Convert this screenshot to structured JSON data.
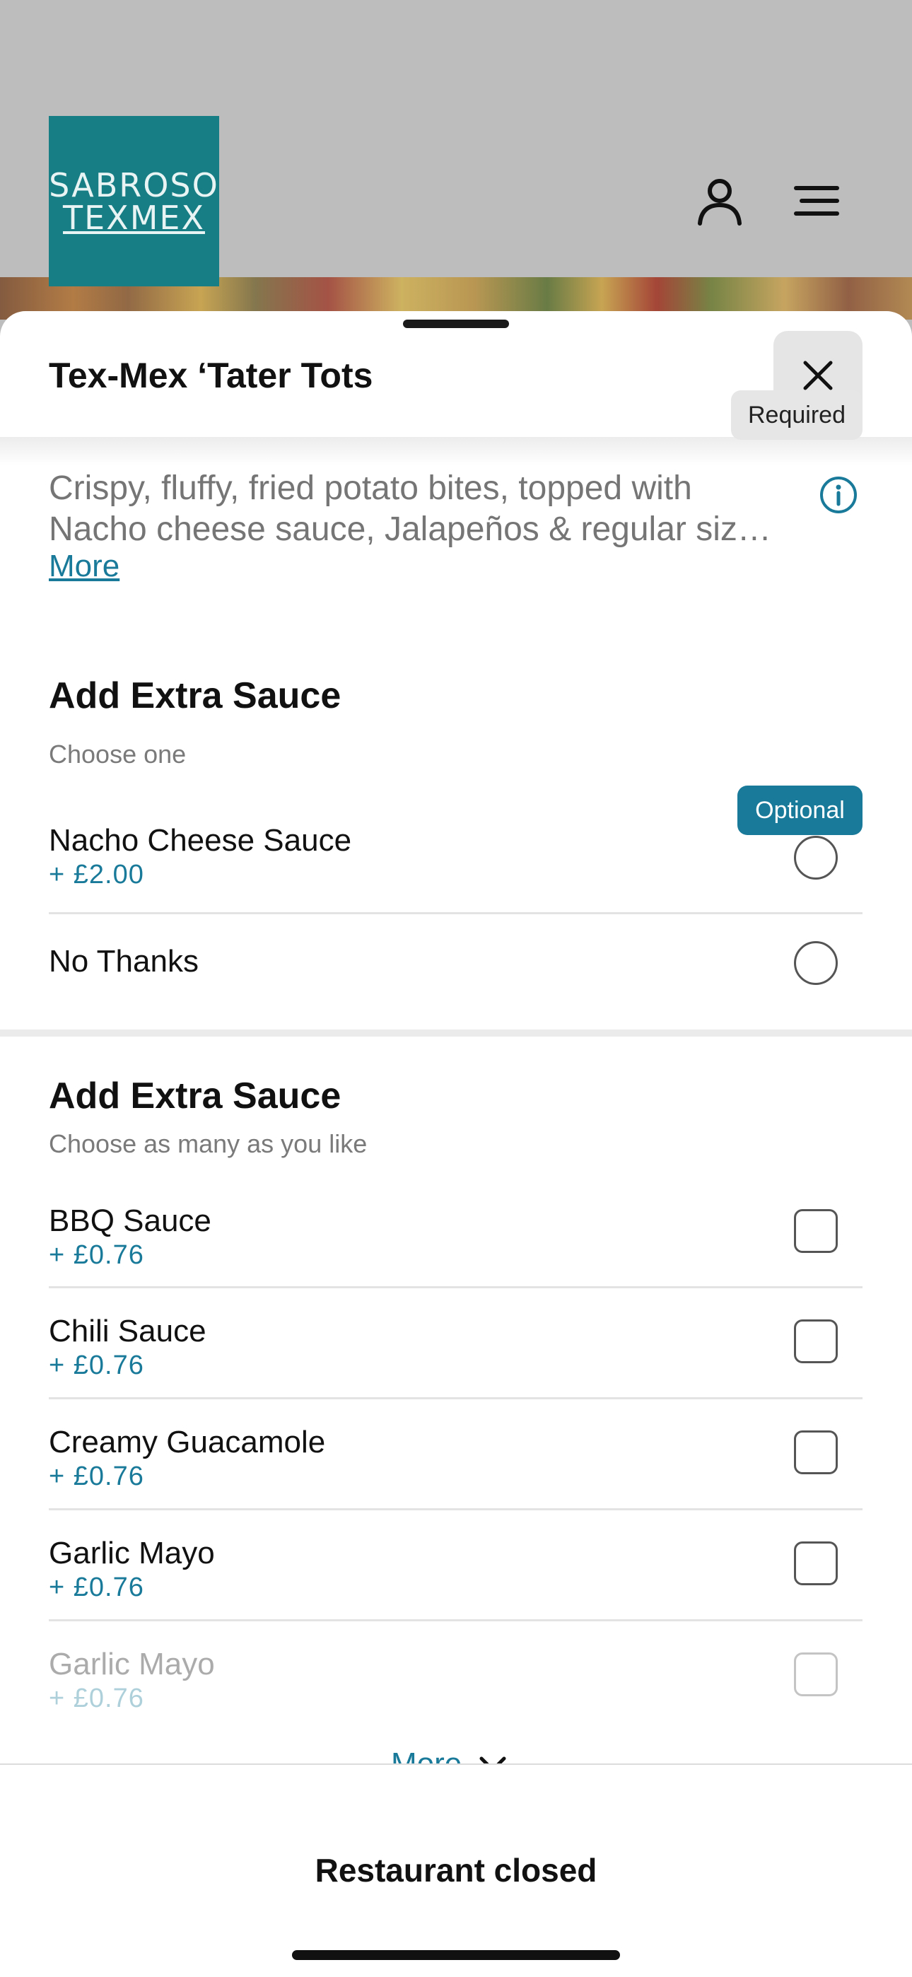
{
  "header": {
    "logo_line1": "SABROSO",
    "logo_line2": "TEXMEX",
    "account_icon": "user-icon",
    "menu_icon": "hamburger-icon"
  },
  "sheet": {
    "title": "Tex-Mex ‘Tater Tots",
    "close_icon": "close-icon",
    "description_line1": "Crispy, fluffy, fried potato bites, topped with",
    "description_line2": "Nacho cheese sauce, Jalapeños & regular siz…",
    "more_link": "More",
    "info_icon": "info-icon"
  },
  "group1": {
    "title": "Add Extra Sauce",
    "subtitle": "Choose one",
    "badge": "Required",
    "options": [
      {
        "name": "Nacho Cheese Sauce",
        "price": "+ £2.00"
      },
      {
        "name": "No Thanks",
        "price": ""
      }
    ]
  },
  "group2": {
    "title": "Add Extra Sauce",
    "subtitle": "Choose as many as you like",
    "badge": "Optional",
    "options": [
      {
        "name": "BBQ Sauce",
        "price": "+ £0.76"
      },
      {
        "name": "Chili Sauce",
        "price": "+ £0.76"
      },
      {
        "name": "Creamy Guacamole",
        "price": "+ £0.76"
      },
      {
        "name": "Garlic Mayo",
        "price": "+ £0.76"
      },
      {
        "name": "Garlic Mayo",
        "price": "+ £0.76"
      }
    ],
    "more_toggle": "More"
  },
  "footer": {
    "status": "Restaurant closed"
  },
  "colors": {
    "accent": "#1a7a99",
    "logo_bg": "#167e84"
  }
}
